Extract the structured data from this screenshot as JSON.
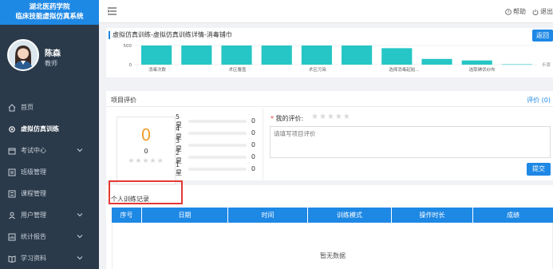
{
  "sidebar": {
    "logo_line1": "湖北医药学院",
    "logo_line2": "临床技能虚拟仿真系统",
    "user_name": "陈森",
    "user_role": "教师",
    "items": [
      {
        "label": "首页",
        "icon": "home-icon",
        "active": false,
        "expandable": false
      },
      {
        "label": "虚拟仿真训练",
        "icon": "settings-icon",
        "active": true,
        "expandable": false
      },
      {
        "label": "考试中心",
        "icon": "calendar-icon",
        "active": false,
        "expandable": true
      },
      {
        "label": "班级管理",
        "icon": "class-icon",
        "active": false,
        "expandable": false
      },
      {
        "label": "课程管理",
        "icon": "course-icon",
        "active": false,
        "expandable": false
      },
      {
        "label": "用户管理",
        "icon": "users-icon",
        "active": false,
        "expandable": true
      },
      {
        "label": "统计报告",
        "icon": "report-icon",
        "active": false,
        "expandable": true
      },
      {
        "label": "学习资料",
        "icon": "book-icon",
        "active": false,
        "expandable": true
      }
    ]
  },
  "header": {
    "help_label": "帮助",
    "exit_label": "退出"
  },
  "breadcrumb": {
    "text": "虚拟仿真训练-虚拟仿真训练详情-消毒铺巾",
    "back_label": "返回"
  },
  "chart_data": {
    "type": "bar",
    "ylim": [
      0,
      500
    ],
    "yticks": [
      "500",
      "0"
    ],
    "categories": [
      "消毒次数",
      "",
      "术区覆盖",
      "",
      "术区污染",
      "",
      "选择消毒起始...",
      "",
      "选取碘伏纱布",
      ""
    ],
    "values": [
      500,
      500,
      500,
      500,
      500,
      500,
      430,
      150,
      110,
      10
    ],
    "right_label": "步骤"
  },
  "rating": {
    "title": "项目评价",
    "link_label": "评价",
    "link_count": "(0)",
    "score": "0",
    "score_count": "0",
    "stars": "★★★★★",
    "rows": [
      {
        "label": "5星",
        "count": "0"
      },
      {
        "label": "4星",
        "count": "0"
      },
      {
        "label": "3星",
        "count": "0"
      },
      {
        "label": "2星",
        "count": "0"
      },
      {
        "label": "1星",
        "count": "0"
      }
    ],
    "my_rating_required": "*",
    "my_rating_label": "我的评价:",
    "placeholder": "请填写项目评价",
    "submit_label": "提交"
  },
  "records": {
    "title": "个人训练记录",
    "columns": [
      "序号",
      "日期",
      "时间",
      "训练模式",
      "操作时长",
      "成绩"
    ],
    "empty_text": "暂无数据"
  },
  "colors": {
    "accent": "#1e88e5",
    "sidebar_bg": "#2b3a4a",
    "bar": "#26c6c6",
    "highlight": "#e53935"
  }
}
